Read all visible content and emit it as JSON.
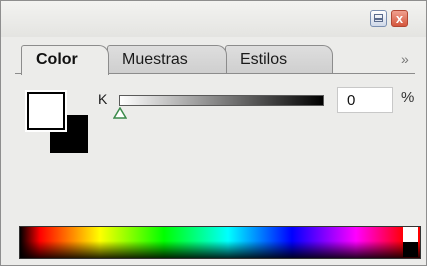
{
  "window": {
    "minimize_icon": "minimize-icon",
    "close_icon": "close-icon",
    "close_glyph": "x"
  },
  "tabs": [
    {
      "label": "Color",
      "active": true
    },
    {
      "label": "Muestras",
      "active": false
    },
    {
      "label": "Estilos",
      "active": false
    }
  ],
  "panel_menu": {
    "glyph": "»",
    "icon": "chevron-double-right-icon"
  },
  "swatches": {
    "foreground_color": "#ffffff",
    "background_color": "#000000"
  },
  "slider": {
    "label": "K",
    "value": "0",
    "unit": "%",
    "level": 0
  },
  "spectrum": {
    "name": "color-spectrum-bar"
  }
}
